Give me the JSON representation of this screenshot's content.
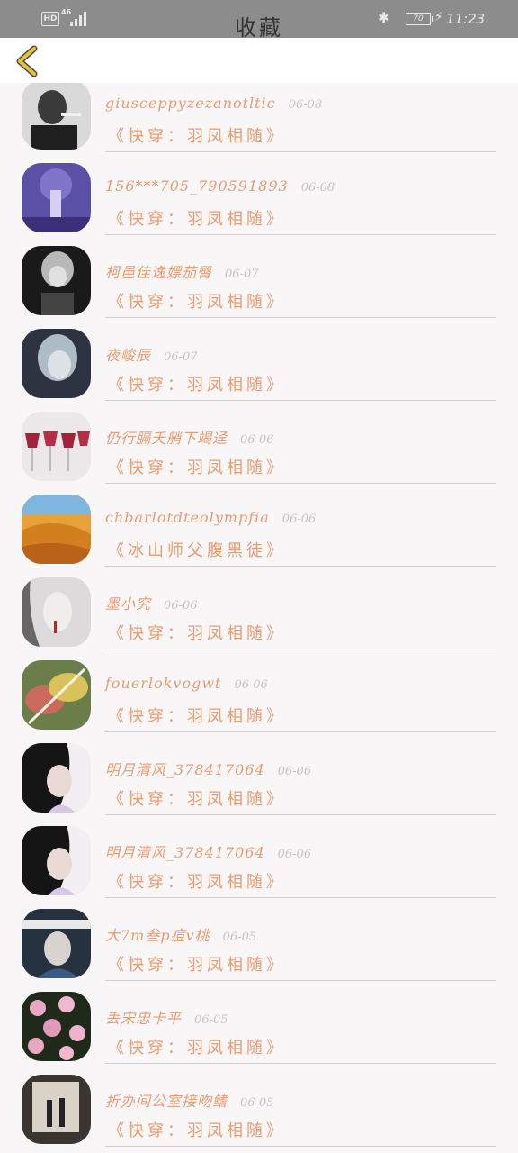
{
  "status_bar": {
    "hd": "HD",
    "network": "46",
    "battery": "70",
    "time": "11:23"
  },
  "header": {
    "title": "收藏"
  },
  "list": [
    {
      "name": "giusceppyzezanotltic",
      "date": "06-08",
      "work": "《快穿：羽凤相随》"
    },
    {
      "name": "156***705_790591893",
      "date": "06-08",
      "work": "《快穿：羽凤相随》"
    },
    {
      "name": "柯邑佳逸嫖茄臀",
      "date": "06-07",
      "work": "《快穿：羽凤相随》"
    },
    {
      "name": "夜峻辰",
      "date": "06-07",
      "work": "《快穿：羽凤相随》"
    },
    {
      "name": "仍行膈夭艄下竭迳",
      "date": "06-06",
      "work": "《快穿：羽凤相随》"
    },
    {
      "name": "chbarlotdteolympfia",
      "date": "06-06",
      "work": "《冰山师父腹黑徒》"
    },
    {
      "name": "墨小究",
      "date": "06-06",
      "work": "《快穿：羽凤相随》"
    },
    {
      "name": "fouerlokvogwt",
      "date": "06-06",
      "work": "《快穿：羽凤相随》"
    },
    {
      "name": "明月清风_378417064",
      "date": "06-06",
      "work": "《快穿：羽凤相随》"
    },
    {
      "name": "明月清风_378417064",
      "date": "06-06",
      "work": "《快穿：羽凤相随》"
    },
    {
      "name": "大7m叁p痘v桃",
      "date": "06-05",
      "work": "《快穿：羽凤相随》"
    },
    {
      "name": "丢宋忠卡平",
      "date": "06-05",
      "work": "《快穿：羽凤相随》"
    },
    {
      "name": "折办间公室接吻鳍",
      "date": "06-05",
      "work": "《快穿：羽凤相随》"
    }
  ],
  "colors": {
    "accent": "#e89c72",
    "back_arrow": "#e5c23a",
    "date": "#c4c4c4",
    "divider": "#d0d0d0",
    "status_bar": "#8c8c8c"
  }
}
